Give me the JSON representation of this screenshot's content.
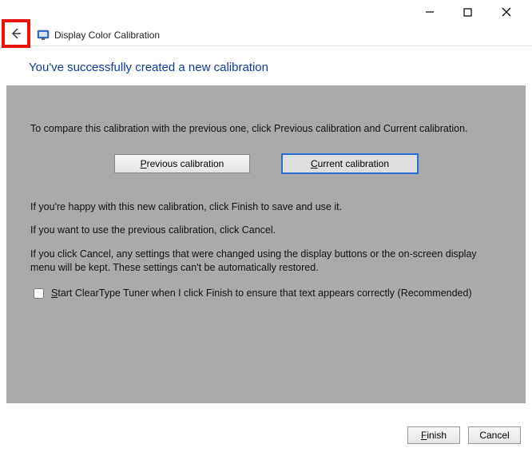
{
  "window": {
    "title": "Display Color Calibration"
  },
  "heading": "You've successfully created a new calibration",
  "panel": {
    "intro": "To compare this calibration with the previous one, click Previous calibration and Current calibration.",
    "previous_btn_prefix": "P",
    "previous_btn_rest": "revious calibration",
    "current_btn_prefix": "C",
    "current_btn_rest": "urrent calibration",
    "happy_text": "If you're happy with this new calibration, click Finish to save and use it.",
    "previous_text": "If you want to use the previous calibration, click Cancel.",
    "cancel_text": "If you click Cancel, any settings that were changed using the display buttons or the on-screen display menu will be kept. These settings can't be automatically restored.",
    "cleartype_prefix": "S",
    "cleartype_rest": "tart ClearType Tuner when I click Finish to ensure that text appears correctly (Recommended)"
  },
  "footer": {
    "finish_prefix": "F",
    "finish_rest": "inish",
    "cancel": "Cancel"
  }
}
